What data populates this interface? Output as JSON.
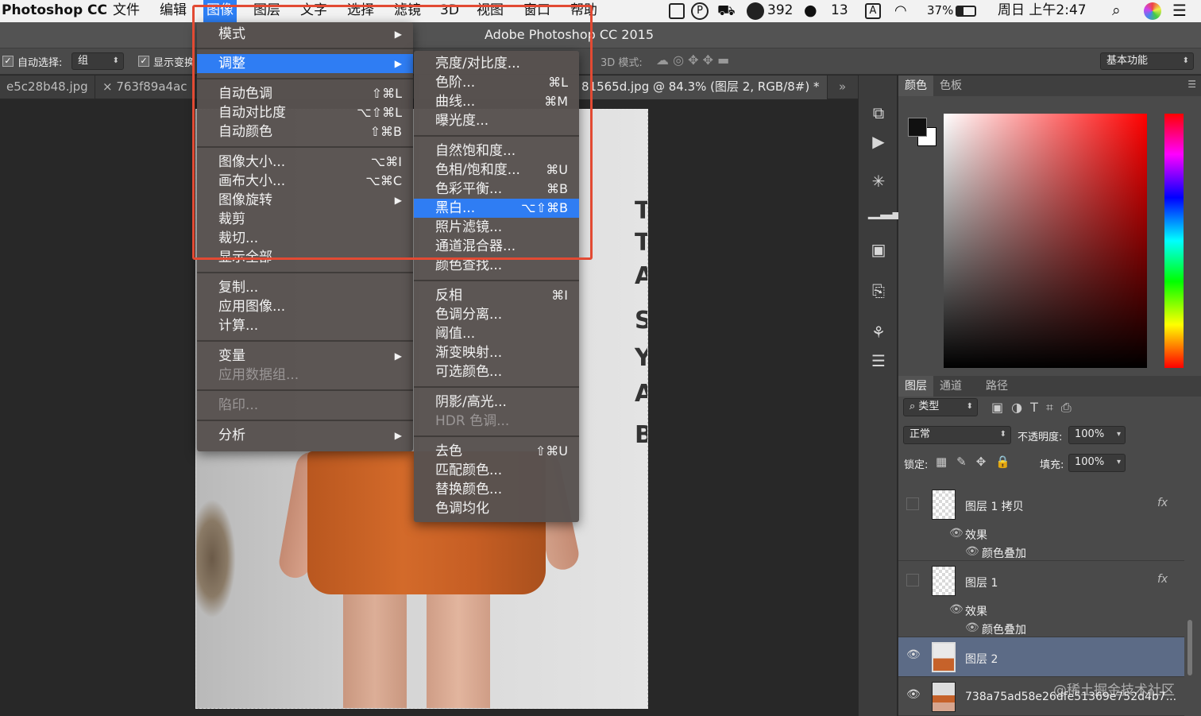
{
  "menubar": {
    "app": "Photoshop CC",
    "items": [
      "文件",
      "编辑",
      "图像",
      "图层",
      "文字",
      "选择",
      "滤镜",
      "3D",
      "视图",
      "窗口",
      "帮助"
    ],
    "status": {
      "badge1": "392",
      "wechat": "13",
      "input": "A",
      "battery": "37%",
      "datetime": "周日 上午2:47"
    }
  },
  "window": {
    "title": "Adobe Photoshop CC 2015"
  },
  "options": {
    "auto_select": "自动选择:",
    "group": "组",
    "show_transform": "显示变换",
    "mode_3d": "3D 模式:",
    "workspace": "基本功能"
  },
  "tabs": [
    "e5c28b48.jpg",
    "763f89a4ac",
    "81565d.jpg @ 84.3% (图层 2, RGB/8#) *"
  ],
  "canvas": {
    "wall_letters": [
      "T",
      "T",
      "A",
      "S",
      "Y",
      "A",
      "B"
    ]
  },
  "image_menu": {
    "items": [
      {
        "label": "模式",
        "shortcut": "",
        "sub": true
      },
      {
        "label": "调整",
        "shortcut": "",
        "sub": true,
        "hl": true
      },
      {
        "label": "自动色调",
        "shortcut": "⇧⌘L"
      },
      {
        "label": "自动对比度",
        "shortcut": "⌥⇧⌘L"
      },
      {
        "label": "自动颜色",
        "shortcut": "⇧⌘B"
      },
      {
        "label": "图像大小...",
        "shortcut": "⌥⌘I"
      },
      {
        "label": "画布大小...",
        "shortcut": "⌥⌘C"
      },
      {
        "label": "图像旋转",
        "shortcut": "",
        "sub": true
      },
      {
        "label": "裁剪",
        "shortcut": ""
      },
      {
        "label": "裁切...",
        "shortcut": ""
      },
      {
        "label": "显示全部",
        "shortcut": ""
      },
      {
        "label": "复制...",
        "shortcut": ""
      },
      {
        "label": "应用图像...",
        "shortcut": ""
      },
      {
        "label": "计算...",
        "shortcut": ""
      },
      {
        "label": "变量",
        "shortcut": "",
        "sub": true
      },
      {
        "label": "应用数据组...",
        "shortcut": "",
        "dis": true
      },
      {
        "label": "陷印...",
        "shortcut": "",
        "dis": true
      },
      {
        "label": "分析",
        "shortcut": "",
        "sub": true
      }
    ]
  },
  "adjust_menu": {
    "items": [
      {
        "label": "亮度/对比度...",
        "shortcut": ""
      },
      {
        "label": "色阶...",
        "shortcut": "⌘L"
      },
      {
        "label": "曲线...",
        "shortcut": "⌘M"
      },
      {
        "label": "曝光度...",
        "shortcut": ""
      },
      {
        "label": "自然饱和度...",
        "shortcut": ""
      },
      {
        "label": "色相/饱和度...",
        "shortcut": "⌘U"
      },
      {
        "label": "色彩平衡...",
        "shortcut": "⌘B"
      },
      {
        "label": "黑白...",
        "shortcut": "⌥⇧⌘B",
        "hl": true
      },
      {
        "label": "照片滤镜...",
        "shortcut": ""
      },
      {
        "label": "通道混合器...",
        "shortcut": ""
      },
      {
        "label": "颜色查找...",
        "shortcut": ""
      },
      {
        "label": "反相",
        "shortcut": "⌘I"
      },
      {
        "label": "色调分离...",
        "shortcut": ""
      },
      {
        "label": "阈值...",
        "shortcut": ""
      },
      {
        "label": "渐变映射...",
        "shortcut": ""
      },
      {
        "label": "可选颜色...",
        "shortcut": ""
      },
      {
        "label": "阴影/高光...",
        "shortcut": ""
      },
      {
        "label": "HDR 色调...",
        "shortcut": "",
        "dis": true
      },
      {
        "label": "去色",
        "shortcut": "⇧⌘U"
      },
      {
        "label": "匹配颜色...",
        "shortcut": ""
      },
      {
        "label": "替换颜色...",
        "shortcut": ""
      },
      {
        "label": "色调均化",
        "shortcut": ""
      }
    ]
  },
  "color_panel": {
    "tabs": [
      "颜色",
      "色板"
    ]
  },
  "layers_panel": {
    "tabs": [
      "图层",
      "通道",
      "路径"
    ],
    "filter": "类型",
    "blend": "正常",
    "opacity_label": "不透明度:",
    "opacity": "100%",
    "lock_label": "锁定:",
    "fill_label": "填充:",
    "fill": "100%",
    "layers": [
      {
        "name": "图层 1 拷贝",
        "fx": "fx",
        "effects": "效果",
        "effect1": "颜色叠加"
      },
      {
        "name": "图层 1",
        "fx": "fx",
        "effects": "效果",
        "effect1": "颜色叠加"
      },
      {
        "name": "图层 2"
      },
      {
        "name": "738a75ad58e26dfe51369e752d4b7..."
      }
    ]
  },
  "watermark": "@稀土掘金技术社区",
  "colors": {
    "highlight": "#2f7df3",
    "redbox": "#e24a33"
  }
}
